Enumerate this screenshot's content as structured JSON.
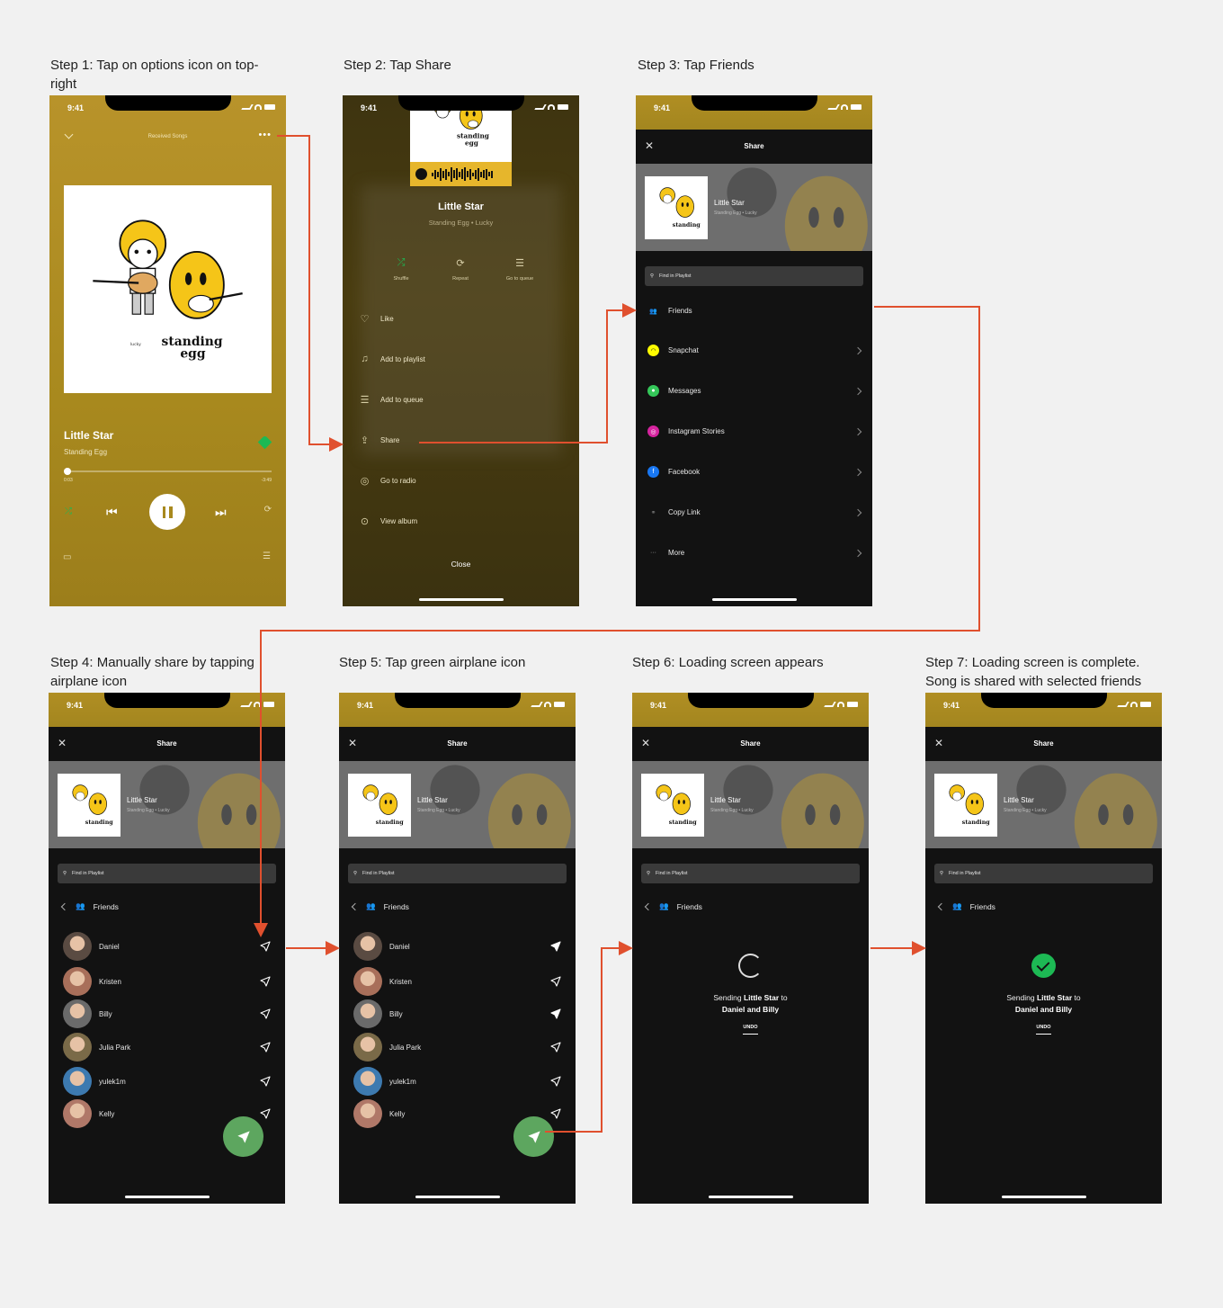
{
  "captions": {
    "step1_line1": "Step 1: Tap on options icon on top-",
    "step1_line2": "right",
    "step2": "Step 2: Tap Share",
    "step3": "Step 3: Tap Friends",
    "step4_line1": "Step 4: Manually share by tapping",
    "step4_line2": "airplane icon",
    "step5": "Step 5: Tap green airplane icon",
    "step6": "Step 6: Loading screen appears",
    "step7_line1": "Step 7: Loading screen is complete.",
    "step7_line2": "Song is shared with selected friends"
  },
  "status": {
    "time": "9:41"
  },
  "player": {
    "header_title": "Received Songs",
    "song": "Little Star",
    "artist": "Standing Egg",
    "elapsed": "0:03",
    "remaining": "-3:49",
    "progress": 0.02
  },
  "menu": {
    "song": "Little Star",
    "subtitle": "Standing Egg • Lucky",
    "actions": [
      "Shuffle",
      "Repeat",
      "Go to queue"
    ],
    "items": [
      "Like",
      "Add to playlist",
      "Add to queue",
      "Share",
      "Go to radio",
      "View album"
    ],
    "close": "Close"
  },
  "share": {
    "title": "Share",
    "song": "Little Star",
    "subtitle": "Standing Egg • Lucky",
    "search_placeholder": "Find in Playlist",
    "targets": [
      "Friends",
      "Snapchat",
      "Messages",
      "Instagram Stories",
      "Facebook",
      "Copy Link",
      "More"
    ],
    "friends_header": "Friends",
    "friends": [
      "Daniel",
      "Kristen",
      "Billy",
      "Julia Park",
      "yulek1m",
      "Kelly"
    ]
  },
  "loading": {
    "prefix": "Sending ",
    "song": "Little Star",
    "mid": " to",
    "recipients": "Daniel and Billy",
    "undo": "UNDO"
  },
  "art_text": {
    "brand_line1": "standing",
    "brand_line2": "egg",
    "album": "lucky"
  },
  "colors": {
    "accent": "#1db954",
    "arrow": "#e0502e",
    "fab": "#5da65f"
  }
}
